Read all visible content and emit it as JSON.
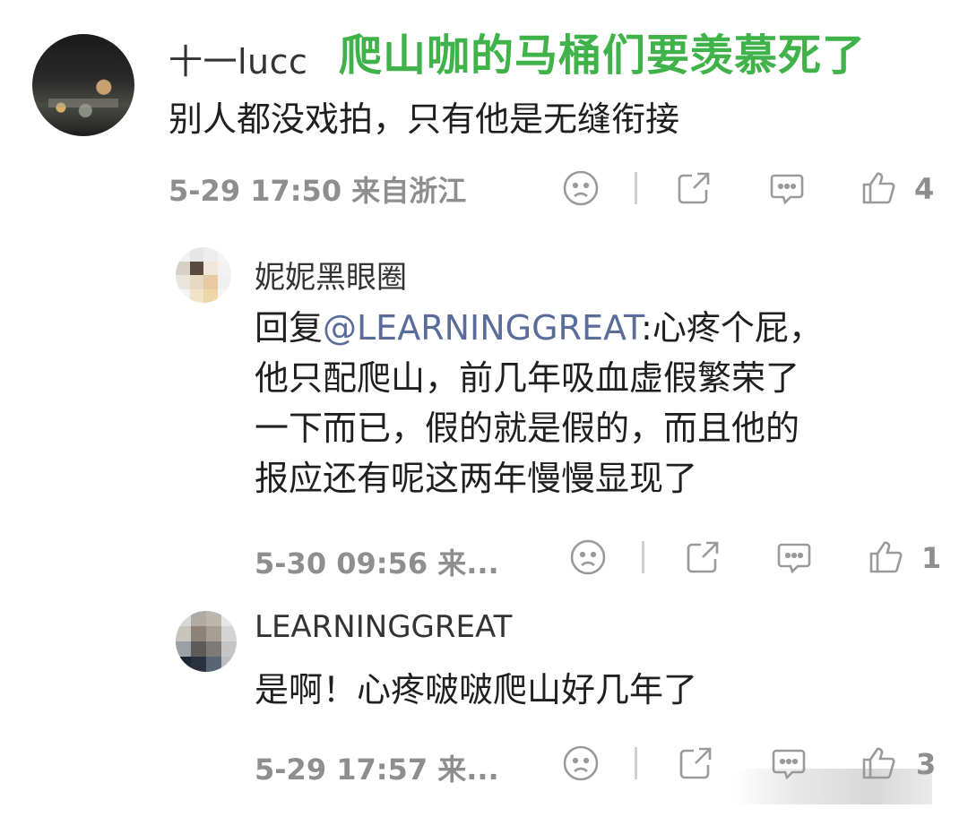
{
  "headline": "爬山咖的马桶们要羡慕死了",
  "main_comment": {
    "username": "十一lucc",
    "text": "别人都没戏拍，只有他是无缝衔接",
    "meta": "5-29 17:50  来自浙江",
    "like_count": "4"
  },
  "replies": [
    {
      "username": "妮妮黑眼圈",
      "reply_prefix": "回复",
      "mention": "@LEARNINGGREAT",
      "line1_rest": ":心疼个屁，",
      "lines": [
        "他只配爬山，前几年吸血虚假繁荣了",
        "一下而已，假的就是假的，而且他的",
        "报应还有呢这两年慢慢显现了"
      ],
      "meta": "5-30 09:56  来...",
      "like_count": "1"
    },
    {
      "username": "LEARNINGGREAT",
      "text": "是啊！心疼啵啵爬山好几年了",
      "meta": "5-29 17:57  来...",
      "like_count": "3"
    }
  ],
  "icons": [
    "dislike-face-icon",
    "share-icon",
    "comment-icon",
    "thumbs-up-icon"
  ],
  "colors": {
    "headline": "#3fb24a",
    "mention": "#5a6d9a",
    "meta": "#8e8e8e"
  }
}
